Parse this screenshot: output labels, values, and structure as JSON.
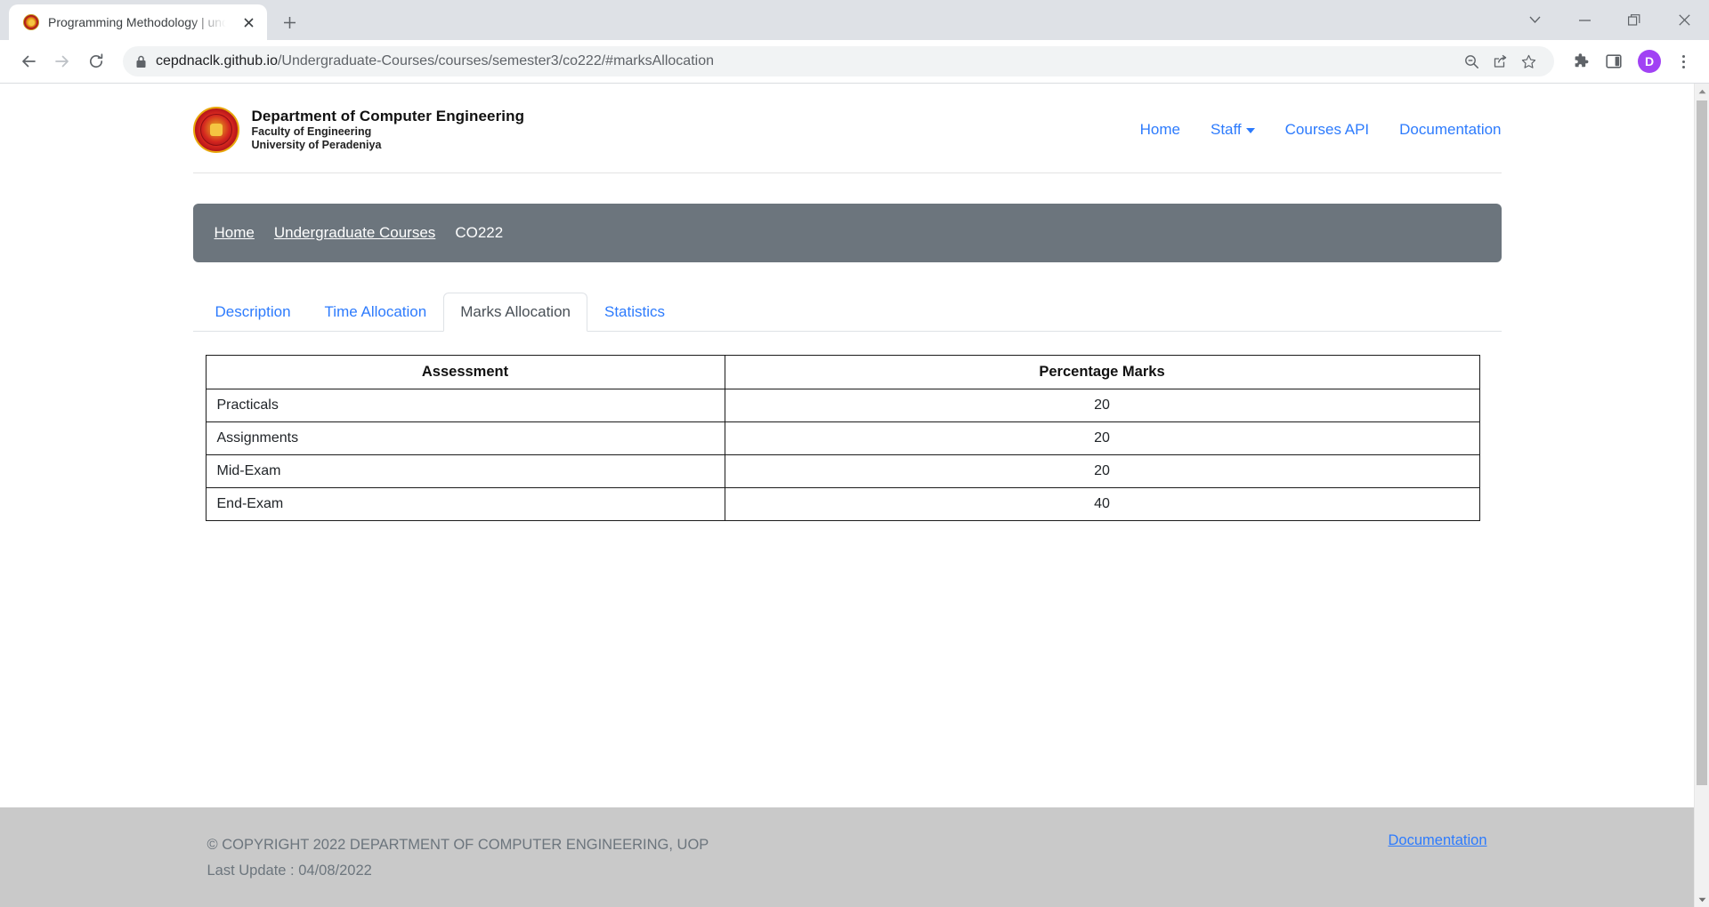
{
  "browser": {
    "tab": {
      "title": "Programming Methodology | und",
      "favicon_icon": "university-crest-icon",
      "close_icon": "close-icon"
    },
    "new_tab_icon": "plus-icon",
    "window_controls": [
      {
        "name": "tab-search-button",
        "icon": "chevron-down-icon"
      },
      {
        "name": "minimize-button",
        "icon": "minimize-icon"
      },
      {
        "name": "maximize-button",
        "icon": "restore-window-icon"
      },
      {
        "name": "close-window-button",
        "icon": "close-icon"
      }
    ],
    "toolbar": {
      "back_icon": "arrow-left-icon",
      "forward_icon": "arrow-right-icon",
      "reload_icon": "reload-icon",
      "lock_icon": "lock-icon",
      "url_host": "cepdnaclk.github.io",
      "url_path": "/Undergraduate-Courses/courses/semester3/co222/#marksAllocation",
      "url_full": "cepdnaclk.github.io/Undergraduate-Courses/courses/semester3/co222/#marksAllocation",
      "omni_icons": [
        {
          "name": "zoom-out-icon",
          "icon": "magnifier-minus-icon"
        },
        {
          "name": "share-icon",
          "icon": "share-icon"
        },
        {
          "name": "bookmark-star-icon",
          "icon": "star-icon"
        }
      ],
      "right_icons": [
        {
          "name": "extensions-button",
          "icon": "puzzle-icon"
        },
        {
          "name": "side-panel-button",
          "icon": "side-panel-icon"
        }
      ],
      "profile_initial": "D",
      "profile_color": "#a142f4",
      "menu_icon": "kebab-menu-icon"
    },
    "scrollbar": {
      "up_icon": "scroll-up-arrow-icon",
      "down_icon": "scroll-down-arrow-icon"
    }
  },
  "site": {
    "header": {
      "crest_icon": "university-crest-icon",
      "line1": "Department of  Computer Engineering",
      "line2": "Faculty of Engineering",
      "line3": "University of Peradeniya",
      "nav": [
        {
          "label": "Home",
          "name": "nav-home",
          "caret": false
        },
        {
          "label": "Staff",
          "name": "nav-staff",
          "caret": true
        },
        {
          "label": "Courses API",
          "name": "nav-courses-api",
          "caret": false
        },
        {
          "label": "Documentation",
          "name": "nav-documentation",
          "caret": false
        }
      ],
      "nav_link_color": "#2d7bfd"
    },
    "breadcrumb": {
      "background": "#6c757d",
      "items": [
        {
          "label": "Home",
          "link": true
        },
        {
          "label": "Undergraduate Courses",
          "link": true
        },
        {
          "label": "CO222",
          "link": false
        }
      ]
    },
    "tabs": [
      {
        "label": "Description",
        "active": false
      },
      {
        "label": "Time Allocation",
        "active": false
      },
      {
        "label": "Marks Allocation",
        "active": true
      },
      {
        "label": "Statistics",
        "active": false
      }
    ],
    "marks_table": {
      "headers": [
        "Assessment",
        "Percentage Marks"
      ],
      "rows": [
        {
          "assessment": "Practicals",
          "percentage": "20"
        },
        {
          "assessment": "Assignments",
          "percentage": "20"
        },
        {
          "assessment": "Mid-Exam",
          "percentage": "20"
        },
        {
          "assessment": "End-Exam",
          "percentage": "40"
        }
      ]
    },
    "footer": {
      "copyright": "© COPYRIGHT 2022 DEPARTMENT OF COMPUTER ENGINEERING, UOP",
      "last_update": "Last Update : 04/08/2022",
      "link_label": "Documentation",
      "background": "#c9c9c9"
    }
  }
}
